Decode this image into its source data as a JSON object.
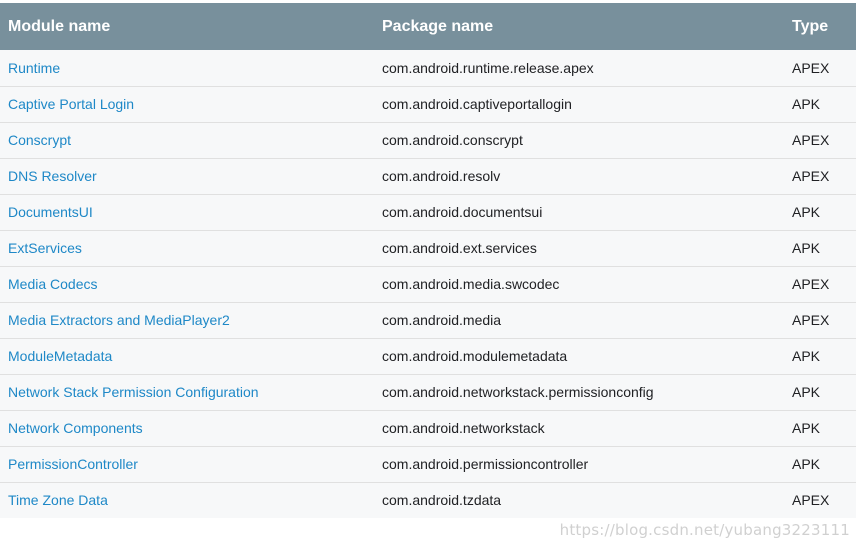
{
  "table": {
    "headers": {
      "module": "Module name",
      "package": "Package name",
      "type": "Type"
    },
    "rows": [
      {
        "module": "Runtime",
        "package": "com.android.runtime.release.apex",
        "type": "APEX"
      },
      {
        "module": "Captive Portal Login",
        "package": "com.android.captiveportallogin",
        "type": "APK"
      },
      {
        "module": "Conscrypt",
        "package": "com.android.conscrypt",
        "type": "APEX"
      },
      {
        "module": "DNS Resolver",
        "package": "com.android.resolv",
        "type": "APEX"
      },
      {
        "module": "DocumentsUI",
        "package": "com.android.documentsui",
        "type": "APK"
      },
      {
        "module": "ExtServices",
        "package": "com.android.ext.services",
        "type": "APK"
      },
      {
        "module": "Media Codecs",
        "package": "com.android.media.swcodec",
        "type": "APEX"
      },
      {
        "module": "Media Extractors and MediaPlayer2",
        "package": "com.android.media",
        "type": "APEX"
      },
      {
        "module": "ModuleMetadata",
        "package": "com.android.modulemetadata",
        "type": "APK"
      },
      {
        "module": "Network Stack Permission Configuration",
        "package": "com.android.networkstack.permissionconfig",
        "type": "APK"
      },
      {
        "module": "Network Components",
        "package": "com.android.networkstack",
        "type": "APK"
      },
      {
        "module": "PermissionController",
        "package": "com.android.permissioncontroller",
        "type": "APK"
      },
      {
        "module": "Time Zone Data",
        "package": "com.android.tzdata",
        "type": "APEX"
      }
    ]
  },
  "watermark": "https://blog.csdn.net/yubang3223111",
  "colors": {
    "header_bg": "#78909c",
    "link": "#1e88c7",
    "row_bg": "#f7f8f9"
  }
}
